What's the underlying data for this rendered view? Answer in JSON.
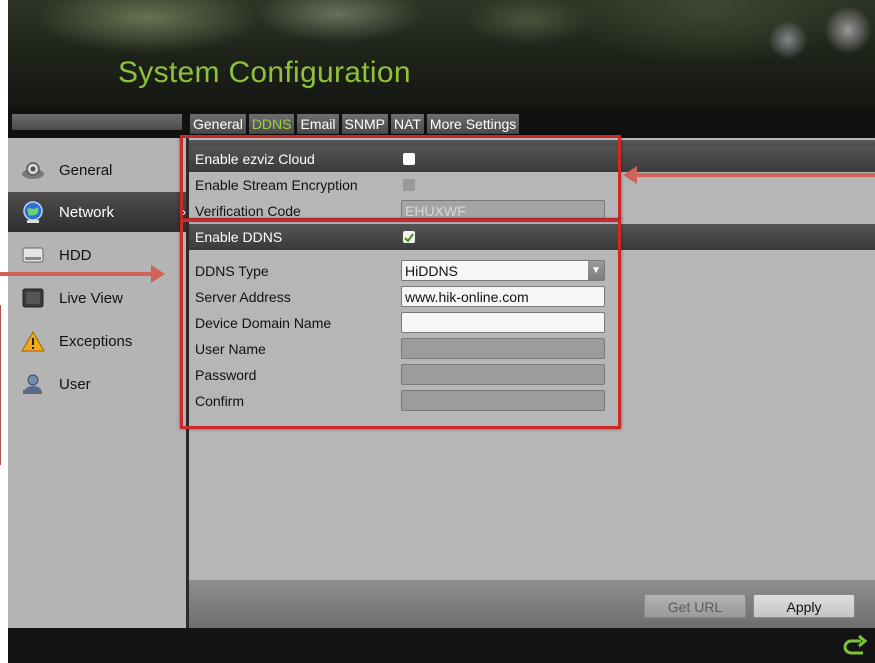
{
  "app": {
    "title": "System Configuration"
  },
  "tabs": [
    {
      "label": "General",
      "active": false
    },
    {
      "label": "DDNS",
      "active": true
    },
    {
      "label": "Email",
      "active": false
    },
    {
      "label": "SNMP",
      "active": false
    },
    {
      "label": "NAT",
      "active": false
    },
    {
      "label": "More Settings",
      "active": false
    }
  ],
  "sidebar": {
    "items": [
      {
        "label": "General",
        "icon": "gear-icon",
        "active": false
      },
      {
        "label": "Network",
        "icon": "globe-icon",
        "active": true
      },
      {
        "label": "HDD",
        "icon": "hdd-icon",
        "active": false
      },
      {
        "label": "Live View",
        "icon": "monitor-icon",
        "active": false
      },
      {
        "label": "Exceptions",
        "icon": "warning-icon",
        "active": false
      },
      {
        "label": "User",
        "icon": "user-icon",
        "active": false
      }
    ]
  },
  "ezviz": {
    "enable_label": "Enable ezviz Cloud",
    "enable_checked": false,
    "encryption_label": "Enable Stream Encryption",
    "encryption_checked": false,
    "verification_label": "Verification Code",
    "verification_value": "EHUXWF"
  },
  "ddns": {
    "enable_label": "Enable DDNS",
    "enable_checked": true,
    "type_label": "DDNS Type",
    "type_value": "HiDDNS",
    "server_label": "Server Address",
    "server_value": "www.hik-online.com",
    "domain_label": "Device Domain Name",
    "domain_value": "",
    "user_label": "User Name",
    "user_value": "",
    "password_label": "Password",
    "password_value": "",
    "confirm_label": "Confirm",
    "confirm_value": ""
  },
  "buttons": {
    "get_url": "Get URL",
    "apply": "Apply"
  },
  "colors": {
    "title": "#8fc13a",
    "active_tab": "#9bd040",
    "highlight": "#cc2a2a",
    "arrow": "#d1625a"
  }
}
